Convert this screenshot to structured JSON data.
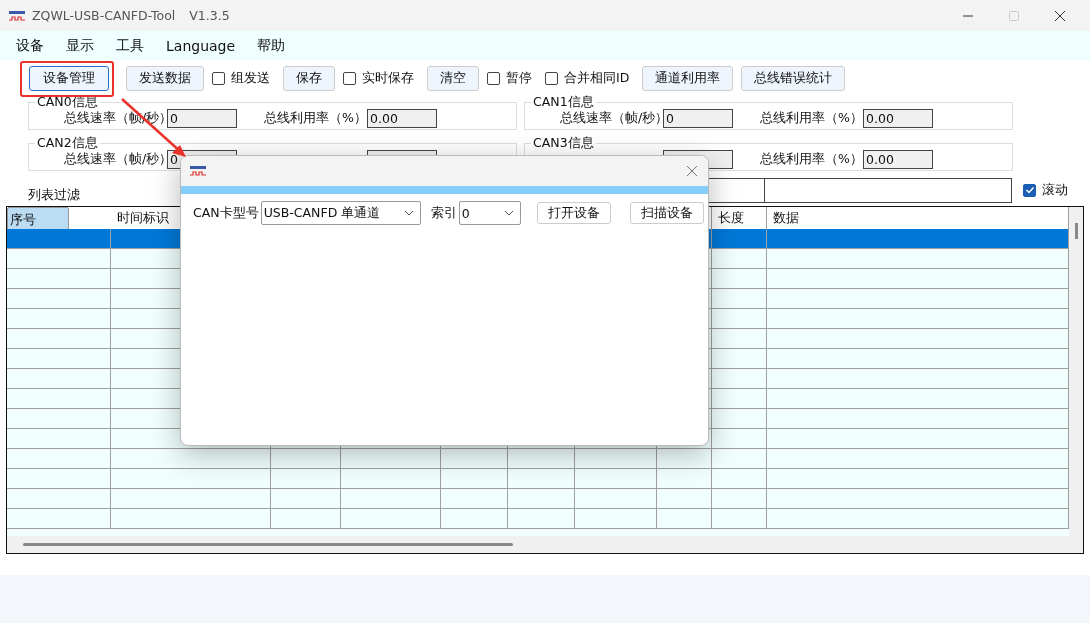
{
  "window": {
    "title": "ZQWL-USB-CANFD-Tool",
    "version": "V1.3.5"
  },
  "menu": [
    "设备",
    "显示",
    "工具",
    "Language",
    "帮助"
  ],
  "toolbar": [
    {
      "kind": "button",
      "label": "设备管理"
    },
    {
      "kind": "button",
      "label": "发送数据"
    },
    {
      "kind": "checkbox",
      "label": "组发送",
      "checked": false
    },
    {
      "kind": "button",
      "label": "保存"
    },
    {
      "kind": "checkbox",
      "label": "实时保存",
      "checked": false
    },
    {
      "kind": "button",
      "label": "清空"
    },
    {
      "kind": "checkbox",
      "label": "暂停",
      "checked": false
    },
    {
      "kind": "checkbox",
      "label": "合并相同ID",
      "checked": false
    },
    {
      "kind": "button",
      "label": "通道利用率"
    },
    {
      "kind": "button",
      "label": "总线错误统计"
    }
  ],
  "channels": [
    {
      "title": "CAN0信息",
      "rate_label": "总线速率（帧/秒）",
      "rate": "0",
      "usage_label": "总线利用率（%）",
      "usage": "0.00"
    },
    {
      "title": "CAN1信息",
      "rate_label": "总线速率（帧/秒）",
      "rate": "0",
      "usage_label": "总线利用率（%）",
      "usage": "0.00"
    },
    {
      "title": "CAN2信息",
      "rate_label": "总线速率（帧/秒）",
      "rate": "0"
    },
    {
      "title": "CAN3信息",
      "usage_label": "总线利用率（%）",
      "usage": "0.00"
    }
  ],
  "filter": {
    "label": "列表过滤",
    "scroll": {
      "label": "滚动",
      "checked": true
    }
  },
  "table": {
    "columns": [
      {
        "label": "序号",
        "selected": true
      },
      {
        "label": "时间标识",
        "selected": false
      },
      {
        "label": "长度",
        "selected": false
      },
      {
        "label": "数据",
        "selected": false
      }
    ],
    "rows": [
      {
        "selected": true
      },
      {
        "selected": false
      },
      {
        "selected": false
      },
      {
        "selected": false
      },
      {
        "selected": false
      },
      {
        "selected": false
      },
      {
        "selected": false
      },
      {
        "selected": false
      },
      {
        "selected": false
      },
      {
        "selected": false
      },
      {
        "selected": false
      },
      {
        "selected": false
      },
      {
        "selected": false
      },
      {
        "selected": false
      },
      {
        "selected": false
      }
    ]
  },
  "dialog": {
    "fields": [
      {
        "label": "CAN卡型号",
        "value": "USB-CANFD 单通道"
      },
      {
        "label": "索引",
        "value": "0"
      }
    ],
    "buttons": [
      "打开设备",
      "扫描设备"
    ]
  }
}
